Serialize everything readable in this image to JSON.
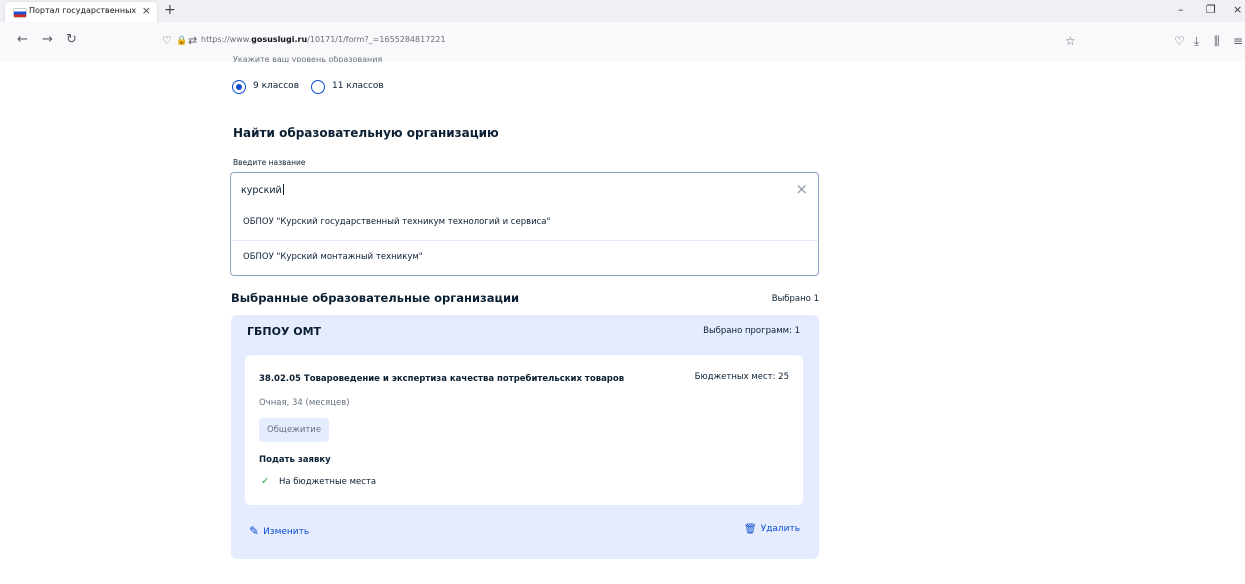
{
  "browser": {
    "tab_title": "Портал государственных усл",
    "tab_close": "×",
    "new_tab": "+",
    "url_prefix": "https://www.",
    "url_domain": "gosuslugi.ru",
    "url_path": "/10171/1/form?_=1655284817221",
    "icons": {
      "back": "←",
      "forward": "→",
      "reload": "↻",
      "shield": "♡",
      "lock": "🔒",
      "permissions": "⇄",
      "star": "☆",
      "pocket": "♡",
      "download": "⤓",
      "library": "⫼",
      "menu": "≡",
      "minimize": "–",
      "restore": "❐",
      "close": "×"
    }
  },
  "form": {
    "clipped_label": "Укажите ваш уровень образования",
    "radio_options": [
      {
        "label": "9 классов",
        "checked": true
      },
      {
        "label": "11 классов",
        "checked": false
      }
    ],
    "find_title": "Найти образовательную организацию",
    "input_label": "Введите название",
    "search_value": "курский",
    "clear_icon": "×",
    "suggestions": [
      "ОБПОУ \"Курский государственный техникум технологий и сервиса\"",
      "ОБПОУ \"Курский монтажный техникум\""
    ]
  },
  "selected": {
    "title": "Выбранные образовательные организации",
    "count_text": "Выбрано 1",
    "org": {
      "name": "ГБПОУ ОМТ",
      "programs_text": "Выбрано программ: 1",
      "program": {
        "title": "38.02.05 Товароведение и экспертиза качества потребительских товаров",
        "budget": "Бюджетных мест: 25",
        "mode": "Очная, 34 (месяцев)",
        "badge": "Общежитие",
        "apply_title": "Подать заявку",
        "apply_option": "На бюджетные места",
        "check_icon": "✓"
      },
      "edit_label": "Изменить",
      "delete_label": "Удалить",
      "edit_icon": "✎",
      "delete_icon": "🗑"
    }
  },
  "colors": {
    "primary": "#0d4cd3",
    "panel_bg": "#e4ecfd",
    "text": "#0b1f33",
    "muted": "#66727f",
    "success": "#2e9b3c"
  }
}
